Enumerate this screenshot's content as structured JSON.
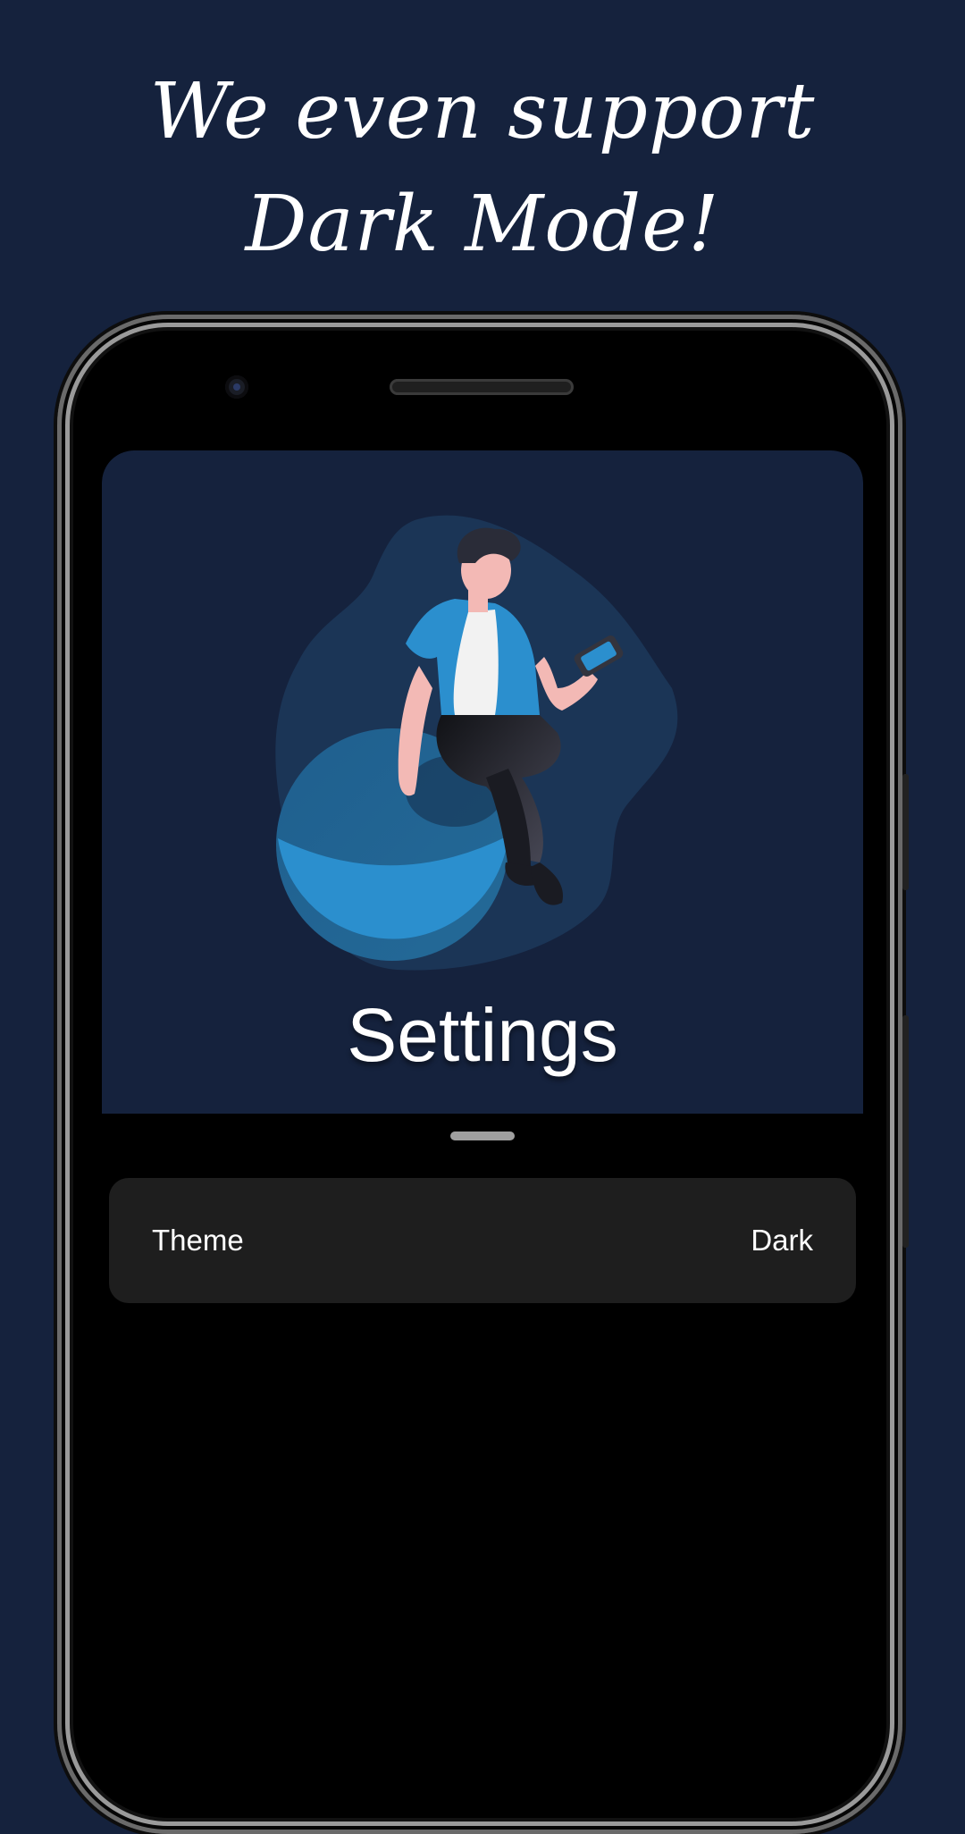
{
  "headline": {
    "line1": "We even support",
    "line2": "Dark Mode!"
  },
  "hero": {
    "title": "Settings",
    "illustration_icon": "person-on-ball-with-phone-illustration"
  },
  "settings": {
    "items": [
      {
        "label": "Theme",
        "value": "Dark"
      }
    ]
  },
  "colors": {
    "background": "#15223d",
    "hero_background": "#15223d",
    "screen_background": "#000000",
    "row_background": "#1e1e1e",
    "accent_blue": "#2b8fce",
    "text": "#ffffff"
  }
}
